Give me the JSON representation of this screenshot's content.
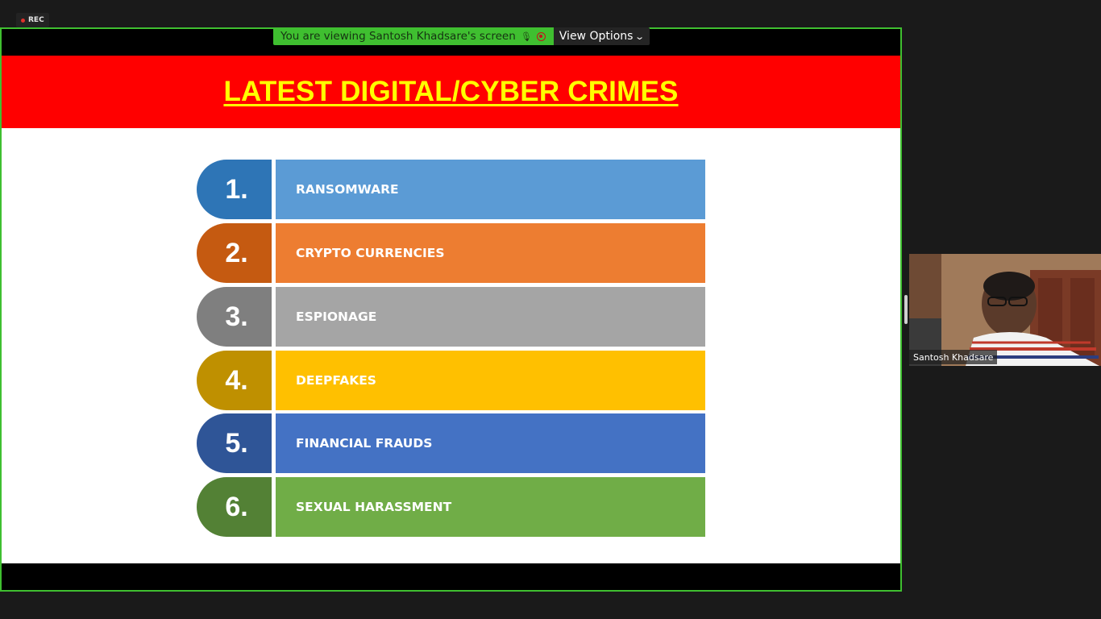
{
  "recording": {
    "label": "REC"
  },
  "share_banner": {
    "viewing_text": "You are viewing Santosh Khadsare's screen",
    "view_options_label": "View Options"
  },
  "slide": {
    "title": "LATEST DIGITAL/CYBER CRIMES",
    "items": [
      {
        "number": "1.",
        "label": "RANSOMWARE",
        "pill_color": "#2e75b6",
        "bar_color": "#5b9bd5"
      },
      {
        "number": "2.",
        "label": "CRYPTO CURRENCIES",
        "pill_color": "#c55a11",
        "bar_color": "#ed7d31"
      },
      {
        "number": "3.",
        "label": "ESPIONAGE",
        "pill_color": "#7f7f7f",
        "bar_color": "#a5a5a5"
      },
      {
        "number": "4.",
        "label": "DEEPFAKES",
        "pill_color": "#bf9000",
        "bar_color": "#ffc000"
      },
      {
        "number": "5.",
        "label": "FINANCIAL FRAUDS",
        "pill_color": "#2f5597",
        "bar_color": "#4472c4"
      },
      {
        "number": "6.",
        "label": "SEXUAL HARASSMENT",
        "pill_color": "#538135",
        "bar_color": "#70ad47"
      }
    ]
  },
  "participant": {
    "name": "Santosh Khadsare"
  },
  "colors": {
    "frame_border": "#3fbf30",
    "header_bg": "#ff0000",
    "title_color": "#ffff00"
  }
}
